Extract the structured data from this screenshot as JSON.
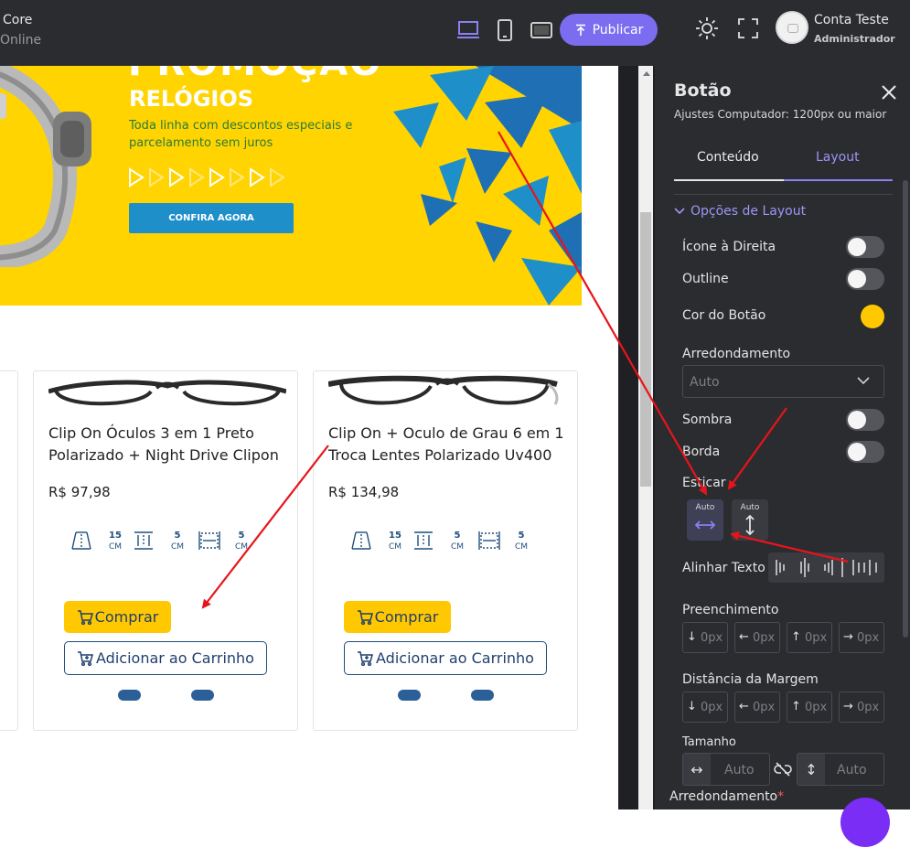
{
  "topbar": {
    "brand_line1": "Core",
    "brand_line2": "Online",
    "publish_label": "Publicar",
    "account_name": "Conta Teste",
    "account_role": "Administrador",
    "active_device": "desktop-icon",
    "accent_color": "#7b6cf0"
  },
  "banner": {
    "title_line1": "PROMOÇÃO",
    "title_line2": "RELÓGIOS",
    "subtitle": "Toda linha com descontos especiais e parcelamento sem juros",
    "cta_label": "CONFIRA AGORA",
    "background_color": "#ffd400"
  },
  "products": [
    {
      "title": "Clip On Óculos 3 em 1 Preto Polarizado + Night Drive Clipon",
      "price": "R$ 97,98",
      "dims": [
        {
          "num": "15",
          "unit": "CM"
        },
        {
          "num": "5",
          "unit": "CM"
        },
        {
          "num": "5",
          "unit": "CM"
        }
      ],
      "buy_label": "Comprar",
      "cart_label": "Adicionar ao Carrinho"
    },
    {
      "title": "Clip On + Oculo de Grau 6 em 1 Troca Lentes Polarizado Uv400",
      "price": "R$ 134,98",
      "dims": [
        {
          "num": "15",
          "unit": "CM"
        },
        {
          "num": "5",
          "unit": "CM"
        },
        {
          "num": "5",
          "unit": "CM"
        }
      ],
      "buy_label": "Comprar",
      "cart_label": "Adicionar ao Carrinho"
    }
  ],
  "panel": {
    "title": "Botão",
    "subtitle": "Ajustes Computador: 1200px ou maior",
    "tabs": [
      {
        "label": "Conteúdo",
        "active": false
      },
      {
        "label": "Layout",
        "active": true
      }
    ],
    "section_label": "Opções de Layout",
    "icon_right_label": "Ícone à Direita",
    "outline_label": "Outline",
    "button_color_label": "Cor do Botão",
    "button_color": "#ffc800",
    "rounding_label": "Arredondamento",
    "rounding_value": "Auto",
    "shadow_label": "Sombra",
    "border_label": "Borda",
    "stretch_label": "Esticar",
    "stretch_h_label": "Auto",
    "stretch_v_label": "Auto",
    "align_label": "Alinhar Texto",
    "padding_label": "Preenchimento",
    "padding": [
      {
        "arrow": "↓",
        "value": "0px"
      },
      {
        "arrow": "←",
        "value": "0px"
      },
      {
        "arrow": "↑",
        "value": "0px"
      },
      {
        "arrow": "→",
        "value": "0px"
      }
    ],
    "margin_label": "Distância da Margem",
    "margin": [
      {
        "arrow": "↓",
        "value": "0px"
      },
      {
        "arrow": "←",
        "value": "0px"
      },
      {
        "arrow": "↑",
        "value": "0px"
      },
      {
        "arrow": "→",
        "value": "0px"
      }
    ],
    "size_label": "Tamanho",
    "size_width": "Auto",
    "size_height": "Auto",
    "bottom_label": "Arredondamento",
    "bottom_required_mark": "*"
  },
  "annotation_color": "#e8141b"
}
